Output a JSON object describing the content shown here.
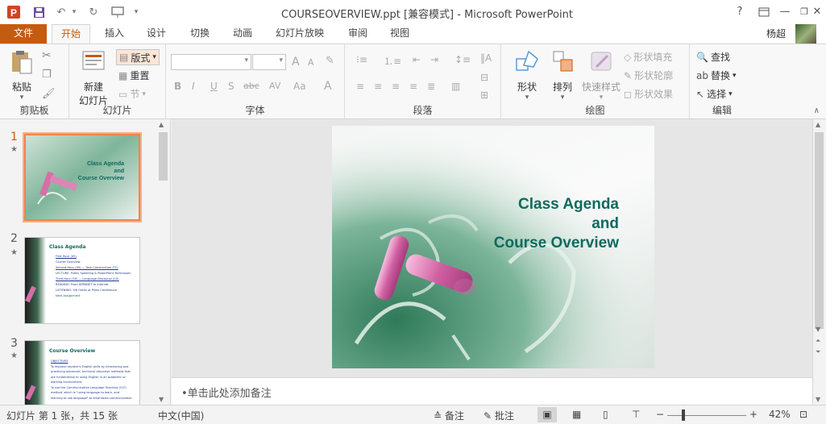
{
  "window": {
    "title": "COURSEOVERVIEW.ppt [兼容模式] - Microsoft PowerPoint",
    "help": "?",
    "minimize": "—",
    "restore": "❐",
    "close": "✕",
    "user": "杨超"
  },
  "tabs": [
    "文件",
    "开始",
    "插入",
    "设计",
    "切换",
    "动画",
    "幻灯片放映",
    "审阅",
    "视图"
  ],
  "ribbon": {
    "clipboard": {
      "label": "剪贴板",
      "paste": "粘贴"
    },
    "slides": {
      "label": "幻灯片",
      "new_slide_l1": "新建",
      "new_slide_l2": "幻灯片",
      "layout": "版式",
      "reset": "重置",
      "section": "节"
    },
    "font": {
      "label": "字体",
      "bold": "B",
      "italic": "I",
      "underline": "U",
      "strike": "S",
      "shadow": "abc",
      "spacing": "AV",
      "case": "Aa",
      "color": "A",
      "grow": "A",
      "shrink": "A"
    },
    "paragraph": {
      "label": "段落"
    },
    "drawing": {
      "label": "绘图",
      "shapes": "形状",
      "arrange": "排列",
      "quick_styles": "快速样式",
      "fill": "形状填充",
      "outline": "形状轮廓",
      "effects": "形状效果"
    },
    "editing": {
      "label": "编辑",
      "find": "查找",
      "replace": "替换",
      "select": "选择"
    }
  },
  "slides": [
    {
      "number": "1",
      "title_l1": "Class Agenda",
      "title_l2": "and",
      "title_l3": "Course Overview"
    },
    {
      "number": "2",
      "title": "Class Agenda",
      "lines": [
        "First Hour (45)",
        "Course Overview",
        "Second Hour (50) — Task Construction (TC)",
        "LECTURE: Public Speaking & PowerPoint Techniques",
        "Third Hour (50) — Language Discourse (LD)",
        "READING: From ARPANET to Internet",
        "LISTENING: 9/8 Oaths at Press Conference",
        "Next Assignment"
      ]
    },
    {
      "number": "3",
      "title": "Course Overview",
      "lines": [
        "OBJECTIVES",
        "To improve student's English skills by introducing and",
        "practicing advanced, technical discourse methods that",
        "are fundamental to using English in an academic or",
        "working environment.",
        "To use the Communicative Language Teaching (CLT)",
        "method, which is \"using language to learn, and",
        "learning to use language\" to emphasize communication"
      ]
    }
  ],
  "main_slide": {
    "title_l1": "Class Agenda",
    "title_l2": "and",
    "title_l3": "Course Overview"
  },
  "notes": {
    "placeholder": "•单击此处添加备注"
  },
  "status": {
    "slide_info": "幻灯片 第 1 张，共 15 张",
    "language": "中文(中国)",
    "notes": "备注",
    "comments": "批注",
    "zoom": "42%"
  },
  "colors": {
    "accent": "#c55a11",
    "title_green": "#0e6a5e",
    "chalk_pink": "#d46fa8"
  }
}
